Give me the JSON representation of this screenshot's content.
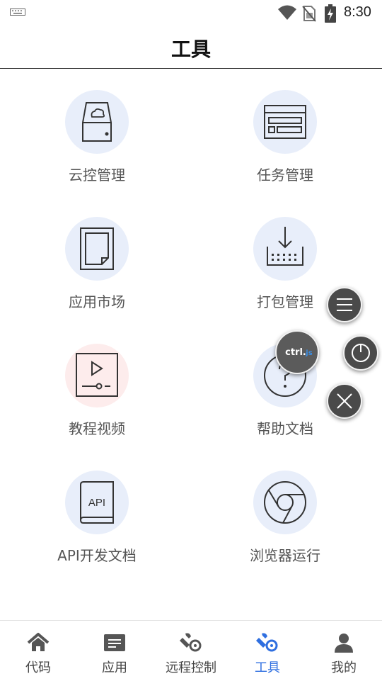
{
  "status_bar": {
    "time": "8:30",
    "icons": [
      "keyboard-icon",
      "wifi-icon",
      "no-sim-icon",
      "battery-charging-icon"
    ]
  },
  "header": {
    "title": "工具"
  },
  "tools": [
    {
      "label": "云控管理",
      "icon": "cloud-storage-icon"
    },
    {
      "label": "任务管理",
      "icon": "task-window-icon"
    },
    {
      "label": "应用市场",
      "icon": "document-page-icon"
    },
    {
      "label": "打包管理",
      "icon": "package-download-icon"
    },
    {
      "label": "教程视频",
      "icon": "video-player-icon"
    },
    {
      "label": "帮助文档",
      "icon": "help-question-icon"
    },
    {
      "label": "API开发文档",
      "icon": "api-book-icon"
    },
    {
      "label": "浏览器运行",
      "icon": "browser-icon"
    }
  ],
  "floating_controls": {
    "logo_text": "ctrl.js",
    "buttons": [
      "menu-icon",
      "power-icon",
      "close-icon"
    ]
  },
  "bottom_nav": {
    "active_color": "#2f6fe0",
    "items": [
      {
        "label": "代码",
        "icon": "home-icon"
      },
      {
        "label": "应用",
        "icon": "app-card-icon"
      },
      {
        "label": "远程控制",
        "icon": "remote-control-icon"
      },
      {
        "label": "工具",
        "icon": "tools-icon",
        "active": true
      },
      {
        "label": "我的",
        "icon": "user-icon"
      }
    ]
  }
}
